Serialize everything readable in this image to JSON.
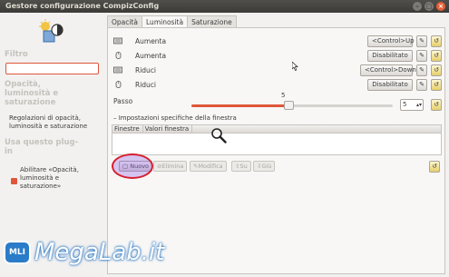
{
  "window": {
    "title": "Gestore configurazione CompizConfig"
  },
  "sidebar": {
    "filter_label": "Filtro",
    "filter_value": "",
    "section_title": "Opacità, luminosità e saturazione",
    "section_desc": "Regolazioni di opacità, luminosità e saturazione",
    "plugin_label": "Usa questo plug-in",
    "enable_text": "Abilitare «Opacità, luminosità e saturazione»",
    "enable_checked": true
  },
  "tabs": [
    {
      "label": "Opacità",
      "active": false
    },
    {
      "label": "Luminosità",
      "active": true
    },
    {
      "label": "Saturazione",
      "active": false
    }
  ],
  "bindings": [
    {
      "icon": "keyboard-icon",
      "label": "Aumenta",
      "value": "<Control>Up"
    },
    {
      "icon": "mouse-icon",
      "label": "Aumenta",
      "value": "Disabilitato"
    },
    {
      "icon": "keyboard-icon",
      "label": "Riduci",
      "value": "<Control>Down"
    },
    {
      "icon": "mouse-icon",
      "label": "Riduci",
      "value": "Disabilitato"
    }
  ],
  "passo": {
    "label": "Passo",
    "value": "5",
    "slider_fraction": 0.48
  },
  "window_specific": {
    "expander_label": "Impostazioni specifiche della finestra",
    "columns": [
      "Finestre",
      "Valori finestra"
    ]
  },
  "actions": {
    "new": "Nuovo",
    "delete": "Elimina",
    "edit": "Modifica",
    "up": "Su",
    "down": "Giù"
  },
  "watermark": {
    "text": "MegaLab.it",
    "badge": "MLI"
  },
  "colors": {
    "accent": "#e0563a",
    "highlight_ring": "#d6202f",
    "titlebar": "#3c3b37"
  }
}
